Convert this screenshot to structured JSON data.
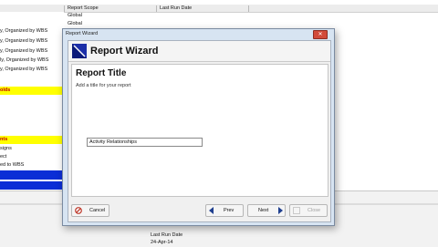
{
  "background": {
    "columns": [
      "Report Scope",
      "Last Run Date"
    ],
    "scope_rows": [
      "Global",
      "Global"
    ],
    "list_rows": [
      {
        "text": "y, Organized by WBS",
        "style": "plain"
      },
      {
        "text": "y, Organized by WBS",
        "style": "plain"
      },
      {
        "text": "y, Organized by WBS",
        "style": "plain"
      },
      {
        "text": "ly, Organized by WBS",
        "style": "plain"
      },
      {
        "text": "y, Organized by WBS",
        "style": "plain"
      },
      {
        "text": "olds",
        "style": "yellow"
      },
      {
        "text": "nts",
        "style": "yellow"
      },
      {
        "text": "signs",
        "style": "plain"
      },
      {
        "text": "ect",
        "style": "plain"
      },
      {
        "text": "ed to WBS",
        "style": "plain"
      }
    ],
    "bottom_header": "Last Run Date",
    "bottom_value": "24-Apr-14"
  },
  "dialog": {
    "window_title": "Report Wizard",
    "close_glyph": "✕",
    "header_title": "Report Wizard",
    "section_title": "Report Title",
    "description": "Add a title for your report",
    "title_value": "Activity Relationships",
    "buttons": {
      "cancel": "Cancel",
      "prev": "Prev",
      "next": "Next",
      "close": "Close"
    }
  }
}
